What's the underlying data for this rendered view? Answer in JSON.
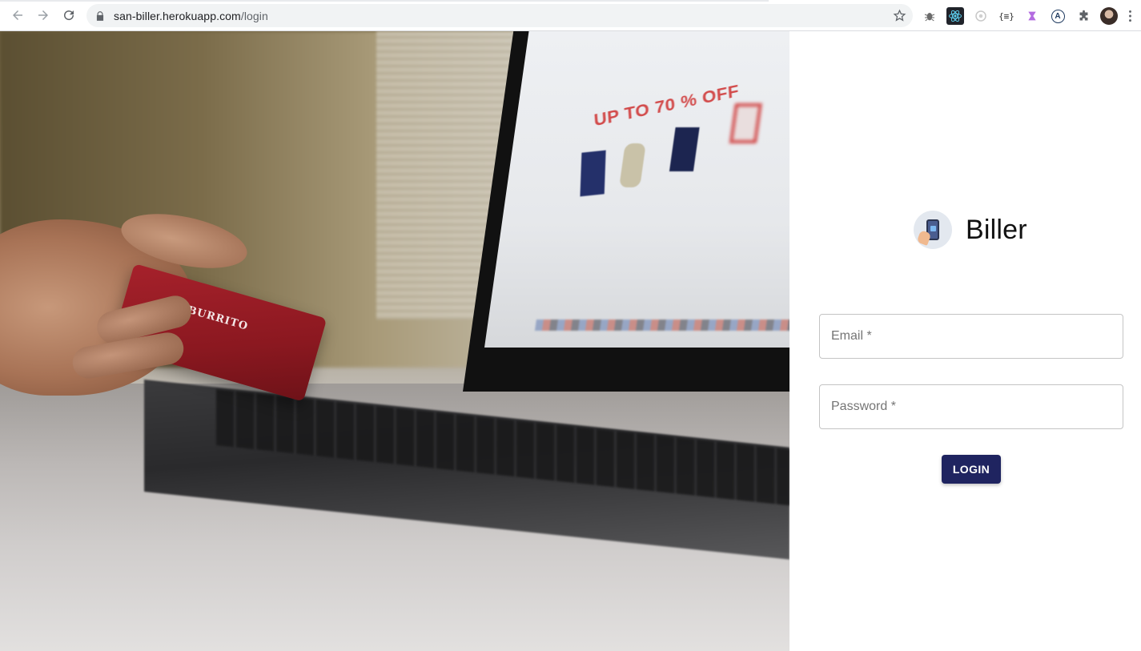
{
  "browser": {
    "url_host": "san-biller.herokuapp.com",
    "url_path": "/login",
    "extensions": [
      "bug-icon",
      "react-icon",
      "circle-dev-icon",
      "json-viewer-icon",
      "gem-icon",
      "a-circle-icon",
      "puzzle-icon"
    ],
    "json_ext_label": "{≡}",
    "a_ext_label": "A"
  },
  "hero": {
    "promo_text": "UP TO 70 % OFF",
    "card_text": "BURRITO"
  },
  "login": {
    "app_name": "Biller",
    "email_placeholder": "Email *",
    "password_placeholder": "Password *",
    "login_label": "LOGIN"
  },
  "colors": {
    "primary": "#1f2460",
    "border": "#c4c4c4",
    "placeholder": "#757575"
  }
}
